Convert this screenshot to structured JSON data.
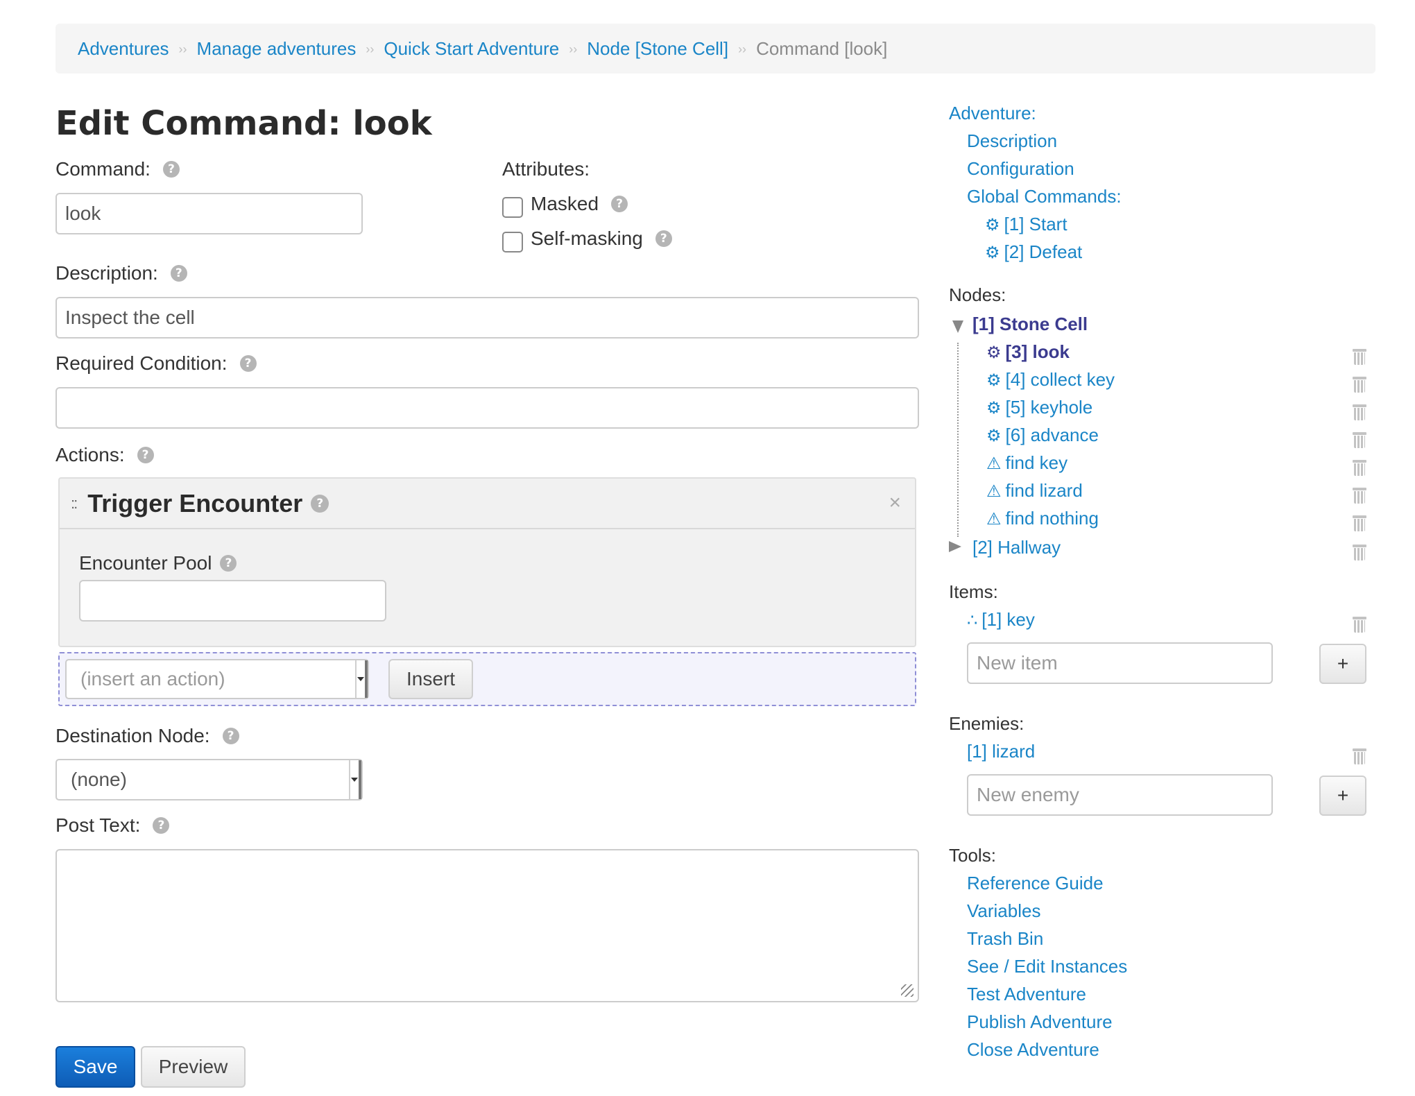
{
  "breadcrumb": {
    "items": [
      "Adventures",
      "Manage adventures",
      "Quick Start Adventure",
      "Node [Stone Cell]"
    ],
    "current": "Command [look]",
    "separator": "››"
  },
  "page": {
    "title": "Edit Command: look"
  },
  "form": {
    "command_label": "Command:",
    "command_value": "look",
    "attributes_label": "Attributes:",
    "masked_label": "Masked",
    "self_masking_label": "Self-masking",
    "description_label": "Description:",
    "description_value": "Inspect the cell",
    "required_condition_label": "Required Condition:",
    "required_condition_value": "",
    "actions_label": "Actions:",
    "action": {
      "drag_icon": "::",
      "title": "Trigger Encounter",
      "close_icon": "×",
      "encounter_pool_label": "Encounter Pool",
      "encounter_pool_value": ""
    },
    "insert_select_placeholder": "(insert an action)",
    "insert_button": "Insert",
    "destination_label": "Destination Node:",
    "destination_value": "(none)",
    "post_text_label": "Post Text:",
    "post_text_value": "",
    "save_button": "Save",
    "preview_button": "Preview",
    "help_icon": "?"
  },
  "sidebar": {
    "adventure_heading": "Adventure:",
    "adventure_links": [
      "Description",
      "Configuration"
    ],
    "global_commands_heading": "Global Commands:",
    "global_commands": [
      "[1] Start",
      "[2] Defeat"
    ],
    "nodes_heading": "Nodes:",
    "node_1": "[1] Stone Cell",
    "node_1_commands": [
      "[3] look",
      "[4] collect key",
      "[5] keyhole",
      "[6] advance"
    ],
    "node_1_warnings": [
      "find key",
      "find lizard",
      "find nothing"
    ],
    "node_2": "[2] Hallway",
    "items_heading": "Items:",
    "items": [
      "[1] key"
    ],
    "new_item_placeholder": "New item",
    "enemies_heading": "Enemies:",
    "enemies": [
      "[1] lizard"
    ],
    "new_enemy_placeholder": "New enemy",
    "add_button": "+",
    "tools_heading": "Tools:",
    "tools": [
      "Reference Guide",
      "Variables",
      "Trash Bin",
      "See / Edit Instances",
      "Test Adventure",
      "Publish Adventure",
      "Close Adventure"
    ],
    "gear_icon": "⚙",
    "warning_icon": "⚠",
    "item_icon": "∴"
  },
  "colors": {
    "link": "#1a85c7",
    "active_node": "#3b3b8f",
    "primary_button": "#0e5cb6"
  }
}
